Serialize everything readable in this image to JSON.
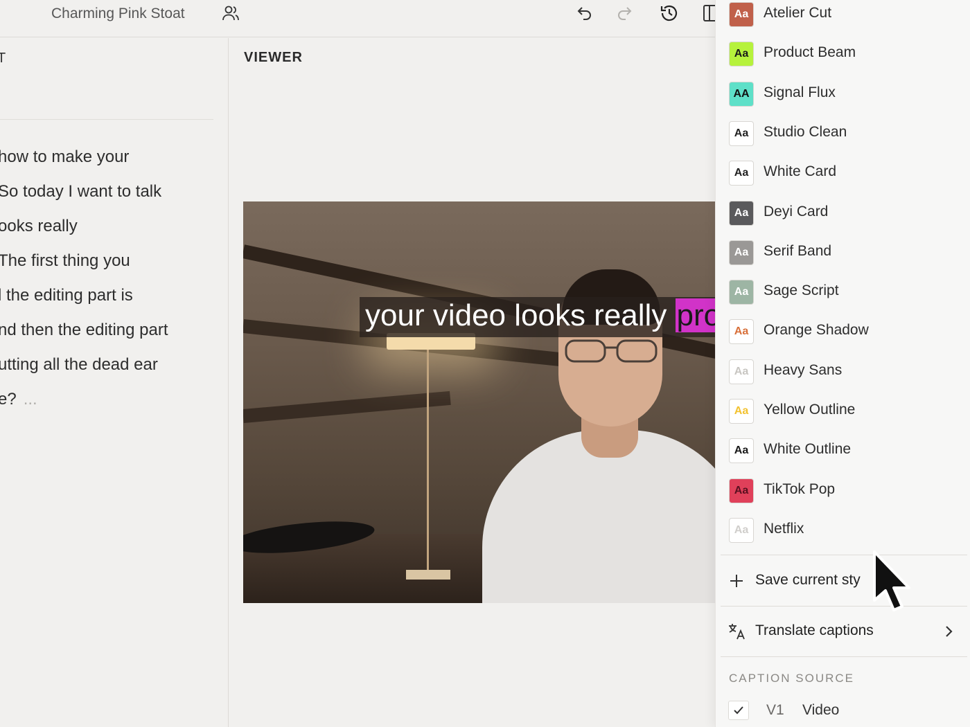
{
  "header": {
    "project_title": "Charming Pink Stoat",
    "icons": [
      "users-icon",
      "undo-icon",
      "redo-icon",
      "history-icon",
      "panel-icon"
    ]
  },
  "script_panel": {
    "header_partial": "T",
    "lines": [
      "how to make your",
      "So today I want to talk",
      "ooks really",
      "The first thing you",
      "l the editing part is",
      "nd then the editing part",
      "utting all the dead ear",
      "e?"
    ],
    "more_indicator": "..."
  },
  "viewer": {
    "title": "VIEWER",
    "caption_text": "your video looks really ",
    "caption_highlight": "pro"
  },
  "styles": [
    {
      "name": "Atelier Cut",
      "swatch_bg": "#c0604a",
      "swatch_fg": "#ffffff"
    },
    {
      "name": "Product Beam",
      "swatch_bg": "#b6f23c",
      "swatch_fg": "#1a1a1a"
    },
    {
      "name": "Signal Flux",
      "swatch_bg": "#5ee0c8",
      "swatch_fg": "#111111"
    },
    {
      "name": "Studio Clean",
      "swatch_bg": "#ffffff",
      "swatch_fg": "#222222"
    },
    {
      "name": "White Card",
      "swatch_bg": "#ffffff",
      "swatch_fg": "#222222"
    },
    {
      "name": "Deyi Card",
      "swatch_bg": "#5a5a5c",
      "swatch_fg": "#ffffff"
    },
    {
      "name": "Serif Band",
      "swatch_bg": "#9a9896",
      "swatch_fg": "#ffffff"
    },
    {
      "name": "Sage Script",
      "swatch_bg": "#9db5a4",
      "swatch_fg": "#ffffff"
    },
    {
      "name": "Orange Shadow",
      "swatch_bg": "#ffffff",
      "swatch_fg": "#d8703a"
    },
    {
      "name": "Heavy Sans",
      "swatch_bg": "#ffffff",
      "swatch_fg": "#c8c6c2"
    },
    {
      "name": "Yellow Outline",
      "swatch_bg": "#ffffff",
      "swatch_fg": "#f2c230"
    },
    {
      "name": "White Outline",
      "swatch_bg": "#ffffff",
      "swatch_fg": "#1a1a1a"
    },
    {
      "name": "TikTok Pop",
      "swatch_bg": "#e0405a",
      "swatch_fg": "#5a1020"
    },
    {
      "name": "Netflix",
      "swatch_bg": "#ffffff",
      "swatch_fg": "#d0cecb"
    }
  ],
  "swatch_glyph": "Aa",
  "signal_swatch_glyph": "AA",
  "actions": {
    "save_style": "Save current sty",
    "translate": "Translate captions"
  },
  "caption_source": {
    "label": "CAPTION SOURCE",
    "track": "V1",
    "name": "Video"
  }
}
